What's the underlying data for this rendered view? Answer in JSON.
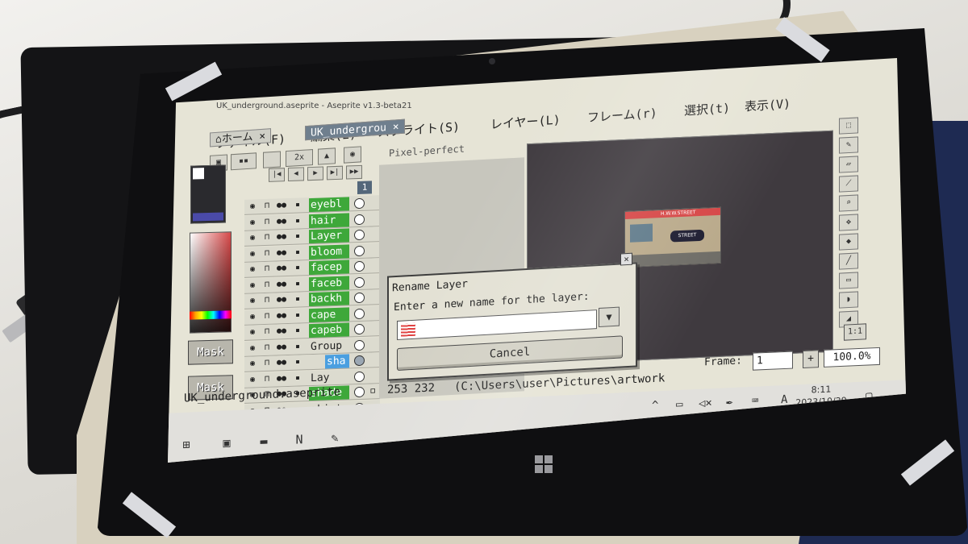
{
  "window": {
    "title": "UK_underground.aseprite - Aseprite v1.3-beta21"
  },
  "menu": {
    "items": [
      {
        "label": "ファイル(F)"
      },
      {
        "label": "編集(E)"
      },
      {
        "label": "スプライト(S)"
      },
      {
        "label": "レイヤー(L)"
      },
      {
        "label": "フレーム(r)"
      },
      {
        "label": "選択(t)"
      },
      {
        "label": "表示(V)"
      }
    ]
  },
  "tabs": [
    {
      "label": "ホーム",
      "close": "×"
    },
    {
      "label": "UK_undergrou",
      "close": "×"
    }
  ],
  "toolbar": {
    "zoom_label": "2x",
    "pixel_perfect_label": "Pixel-perfect"
  },
  "timeline": {
    "frame_number": "1",
    "layers": [
      {
        "name": "eyebl",
        "style": "green"
      },
      {
        "name": "hair",
        "style": "green"
      },
      {
        "name": "Layer",
        "style": "green"
      },
      {
        "name": "bloom",
        "style": "green"
      },
      {
        "name": "facep",
        "style": "green"
      },
      {
        "name": "faceb",
        "style": "green"
      },
      {
        "name": "backh",
        "style": "green"
      },
      {
        "name": "cape",
        "style": "green"
      },
      {
        "name": "capeb",
        "style": "green"
      },
      {
        "name": "Group",
        "style": "plain"
      },
      {
        "name": "sha",
        "style": "blue"
      },
      {
        "name": "Lay",
        "style": "plain"
      },
      {
        "name": "shade",
        "style": "green"
      },
      {
        "name": "skirt",
        "style": "plain"
      }
    ]
  },
  "palette": {
    "mask_label_1": "Mask",
    "mask_label_2": "Mask",
    "primary_color": "#d84a4a"
  },
  "canvas": {
    "sprite_sign": "H.W.W.STREET",
    "sprite_roundel": "STREET",
    "background_color": "#3f3a3f"
  },
  "tools": {
    "one_to_one_label": "1:1"
  },
  "dialog": {
    "title": "Rename Layer",
    "close": "×",
    "prompt": "Enter a new name for the layer:",
    "input_value": "",
    "dropdown_glyph": "▼",
    "cancel_label": "Cancel"
  },
  "frame_controls": {
    "frame_label": "Frame:",
    "frame_value": "1",
    "plus_label": "+",
    "zoom_value": "100.0%"
  },
  "status": {
    "filename": "UK_underground.aseprite",
    "coords": "253 232",
    "path": "(C:\\Users\\user\\Pictures\\artwork"
  },
  "taskbar": {
    "time": "8:11",
    "date": "2023/10/29",
    "ime": "A"
  }
}
